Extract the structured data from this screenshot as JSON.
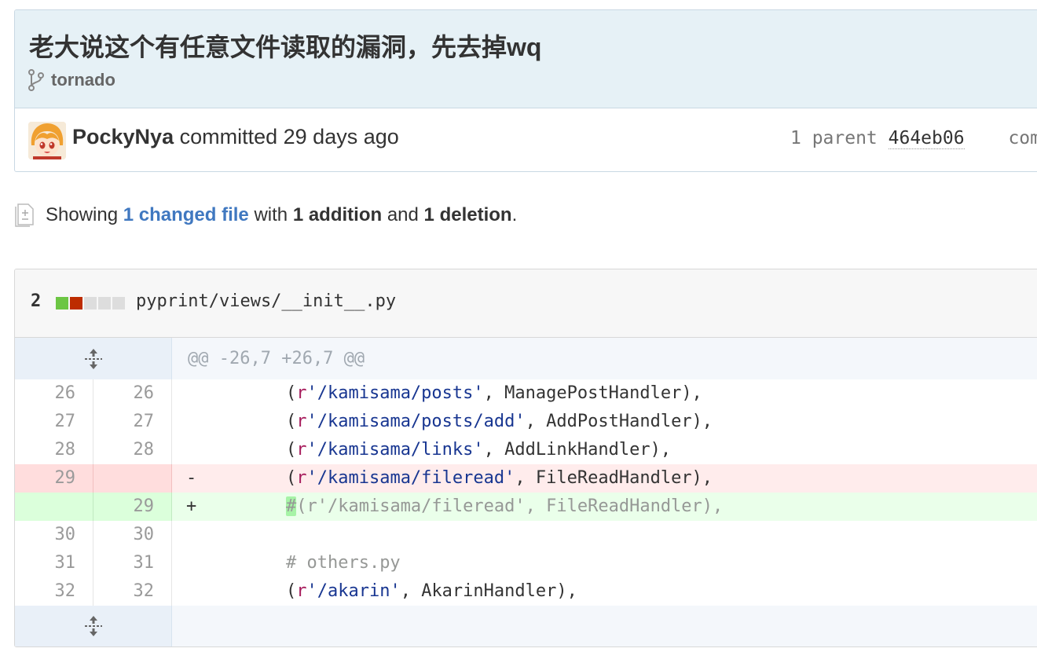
{
  "commit": {
    "title": "老大说这个有任意文件读取的漏洞，先去掉wq",
    "branch_icon": "git-branch-icon",
    "branch": "tornado",
    "author": "PockyNya",
    "committed_text": "committed 29 days ago",
    "parent_label": "1 parent",
    "parent_sha": "464eb06",
    "commit_label_partial": "com"
  },
  "summary": {
    "icon": "file-diff-icon",
    "prefix": "Showing",
    "changed_files_link": "1 changed file",
    "with": "with",
    "additions": "1 addition",
    "and": "and",
    "deletions": "1 deletion",
    "suffix": "."
  },
  "file": {
    "diff_count": "2",
    "path": "pyprint/views/__init__.py",
    "diffstat_colors": [
      "#6cc644",
      "#bd2c00",
      "#dddddd",
      "#dddddd",
      "#dddddd"
    ],
    "expand_icon": "unfold-icon",
    "hunk_header": "@@ -26,7 +26,7 @@",
    "lines": [
      {
        "type": "ctx",
        "old": "26",
        "new": "26",
        "marker": "",
        "indent": "    ",
        "open": "(",
        "prefix": "r",
        "str": "'/kamisama/posts'",
        "rest": ", ManagePostHandler),"
      },
      {
        "type": "ctx",
        "old": "27",
        "new": "27",
        "marker": "",
        "indent": "    ",
        "open": "(",
        "prefix": "r",
        "str": "'/kamisama/posts/add'",
        "rest": ", AddPostHandler),"
      },
      {
        "type": "ctx",
        "old": "28",
        "new": "28",
        "marker": "",
        "indent": "    ",
        "open": "(",
        "prefix": "r",
        "str": "'/kamisama/links'",
        "rest": ", AddLinkHandler),"
      },
      {
        "type": "del",
        "old": "29",
        "new": "",
        "marker": "-",
        "indent": "    ",
        "open": "(",
        "prefix": "r",
        "str": "'/kamisama/fileread'",
        "rest": ", FileReadHandler),"
      },
      {
        "type": "add",
        "old": "",
        "new": "29",
        "marker": "+",
        "indent": "    ",
        "hl": "#",
        "comment": "(r'/kamisama/fileread', FileReadHandler),"
      },
      {
        "type": "ctx",
        "old": "30",
        "new": "30",
        "marker": "",
        "indent": "",
        "blank": true
      },
      {
        "type": "ctx",
        "old": "31",
        "new": "31",
        "marker": "",
        "indent": "    ",
        "comment_only": "# others.py"
      },
      {
        "type": "ctx",
        "old": "32",
        "new": "32",
        "marker": "",
        "indent": "    ",
        "open": "(",
        "prefix": "r",
        "str": "'/akarin'",
        "rest": ", AkarinHandler),"
      }
    ]
  }
}
